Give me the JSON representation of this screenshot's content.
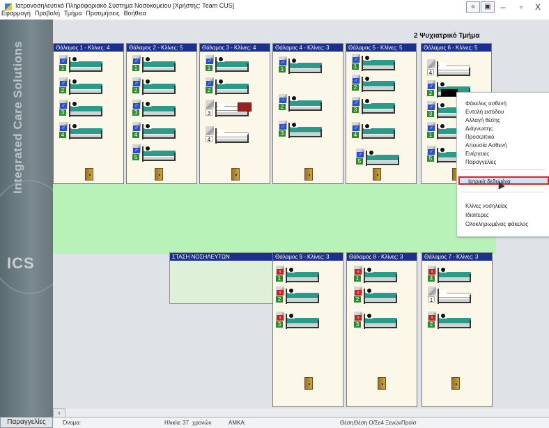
{
  "window": {
    "title": "Ιατρονοσηλευτικό Πληροφοριακό Σύστημα Νοσοκομείου [Χρήστης: Team CUS]",
    "toolbar_back": "«",
    "toolbar_btn": "▣",
    "minimize": "–",
    "maximize": "▫",
    "close": "X"
  },
  "menubar": [
    "Εφαρμογή",
    "Προβολή",
    "Τμήμα",
    "Προτιμήσεις",
    "Βοήθεια"
  ],
  "left_panel": {
    "vertical_logo": "Integrated Care Solutions",
    "ics": "ICS",
    "notifications_button": "Παραγγελίες"
  },
  "department": {
    "title": "2 Ψυχιατρικό Τμήμα"
  },
  "rooms_top": [
    {
      "label": "Θάλαμος 1 - Κλίνες: 4"
    },
    {
      "label": "Θάλαμος 2 - Κλίνες: 5"
    },
    {
      "label": "Θάλαμος 3 - Κλίνες: 4"
    },
    {
      "label": "Θάλαμος 4 - Κλίνες: 3"
    },
    {
      "label": "Θάλαμος 5 - Κλίνες: 5"
    },
    {
      "label": "Θάλαμος 6 - Κλίνες: 5"
    }
  ],
  "rooms_bottom": [
    {
      "label": "Θάλαμος 9 - Κλίνες: 3"
    },
    {
      "label": "Θάλαμος 8 - Κλίνες: 3"
    },
    {
      "label": "Θάλαμος 7 - Κλίνες: 3"
    }
  ],
  "nurses_station": {
    "label": "ΣΤΑΣΗ ΝΟΣΗΛΕΥΤΩΝ"
  },
  "beds": {
    "r1": [
      "1",
      "2",
      "3",
      "4"
    ],
    "r2": [
      "1",
      "2",
      "3",
      "4",
      "5"
    ],
    "r3": [
      "1",
      "2",
      "3",
      "4"
    ],
    "r4": [
      "1",
      "2",
      "3"
    ],
    "r5": [
      "1",
      "2",
      "3",
      "4",
      "5"
    ],
    "r6": [
      "4",
      "2",
      "3",
      "1",
      "5"
    ],
    "r9": [
      "1",
      "2",
      "3"
    ],
    "r8": [
      "1",
      "2",
      "3"
    ],
    "r7": [
      "4",
      "1",
      "2"
    ]
  },
  "context_menu": {
    "items": [
      "Φάκελος ασθενή",
      "Εντολή εισόδου",
      "Αλλαγή θέσης",
      "Διάγνωσης",
      "Προσωπικό",
      "Απουσία Ασθενή",
      "Ενέργειες",
      "Παραγγελίες",
      "Ιατρικά δεδομένα",
      "Κλίνες νοσηλείας",
      "Ιδιαιτερες",
      "Ολοκληρωμένος φάκελος"
    ],
    "selected_index": 8
  },
  "statusbar": {
    "patient_label": "Όνομα:",
    "age_label": "Ηλικία:",
    "age_value": "37",
    "age_unit": "χρονών",
    "amka_label": "ΑΜΚΑ:",
    "position_label": "Θέση:",
    "position_value": "Θέση Ο/Σε4 ΞενώνΠροϊσ"
  }
}
